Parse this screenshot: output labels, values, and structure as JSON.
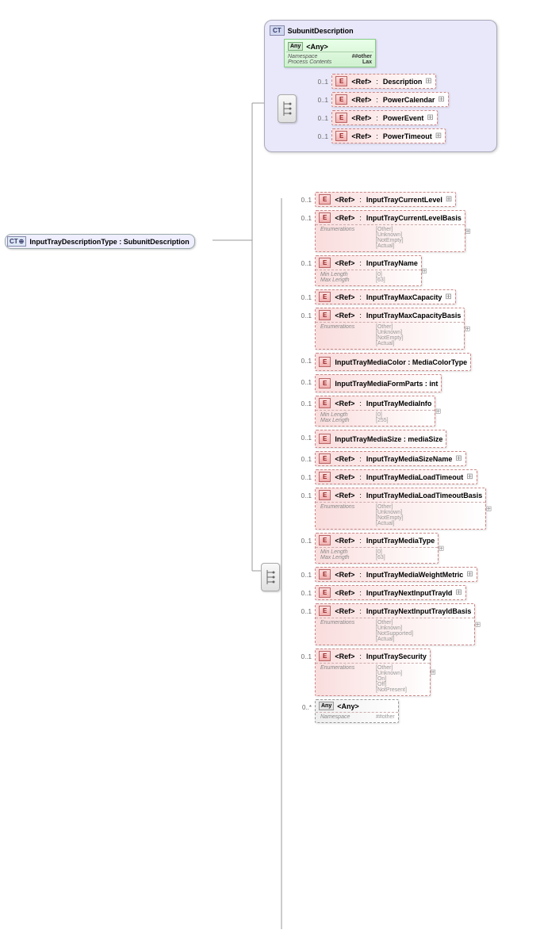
{
  "root": {
    "label": "InputTrayDescriptionType : SubunitDescription",
    "ct": "CT"
  },
  "subunit": {
    "ct": "CT",
    "title": "SubunitDescription",
    "any": {
      "ic": "Any",
      "label": "<Any>",
      "ns_l": "Namespace",
      "ns_v": "##other",
      "pc_l": "Process Contents",
      "pc_v": "Lax"
    },
    "items": [
      {
        "occ": "0..1",
        "ref": "<Ref>",
        "name": "Description"
      },
      {
        "occ": "0..1",
        "ref": "<Ref>",
        "name": "PowerCalendar"
      },
      {
        "occ": "0..1",
        "ref": "<Ref>",
        "name": "PowerEvent"
      },
      {
        "occ": "0..1",
        "ref": "<Ref>",
        "name": "PowerTimeout"
      }
    ]
  },
  "main": [
    {
      "occ": "0..1",
      "ref": "<Ref>",
      "name": "InputTrayCurrentLevel"
    },
    {
      "occ": "0..1",
      "ref": "<Ref>",
      "name": "InputTrayCurrentLevelBasis",
      "enum": [
        "[Other]",
        "[Unknown]",
        "[NotEmpty]",
        "[Actual]"
      ],
      "enum_l": "Enumerations"
    },
    {
      "occ": "0..1",
      "ref": "<Ref>",
      "name": "InputTrayName",
      "len": {
        "min_l": "Min Length",
        "min_v": "[0]",
        "max_l": "Max Length",
        "max_v": "[63]"
      }
    },
    {
      "occ": "0..1",
      "ref": "<Ref>",
      "name": "InputTrayMaxCapacity"
    },
    {
      "occ": "0..1",
      "ref": "<Ref>",
      "name": "InputTrayMaxCapacityBasis",
      "enum": [
        "[Other]",
        "[Unknown]",
        "[NotEmpty]",
        "[Actual]"
      ],
      "enum_l": "Enumerations"
    },
    {
      "occ": "0..1",
      "plain": "InputTrayMediaColor : MediaColorType"
    },
    {
      "occ": "0..1",
      "plain": "InputTrayMediaFormParts : int"
    },
    {
      "occ": "0..1",
      "ref": "<Ref>",
      "name": "InputTrayMediaInfo",
      "len": {
        "min_l": "Min Length",
        "min_v": "[0]",
        "max_l": "Max Length",
        "max_v": "[255]"
      }
    },
    {
      "occ": "0..1",
      "plain": "InputTrayMediaSize : mediaSize"
    },
    {
      "occ": "0..1",
      "ref": "<Ref>",
      "name": "InputTrayMediaSizeName"
    },
    {
      "occ": "0..1",
      "ref": "<Ref>",
      "name": "InputTrayMediaLoadTimeout"
    },
    {
      "occ": "0..1",
      "ref": "<Ref>",
      "name": "InputTrayMediaLoadTimeoutBasis",
      "enum": [
        "[Other]",
        "[Unknown]",
        "[NotEmpty]",
        "[Actual]"
      ],
      "enum_l": "Enumerations"
    },
    {
      "occ": "0..1",
      "ref": "<Ref>",
      "name": "InputTrayMediaType",
      "len": {
        "min_l": "Min Length",
        "min_v": "[0]",
        "max_l": "Max Length",
        "max_v": "[63]"
      }
    },
    {
      "occ": "0..1",
      "ref": "<Ref>",
      "name": "InputTrayMediaWeightMetric"
    },
    {
      "occ": "0..1",
      "ref": "<Ref>",
      "name": "InputTrayNextInputTrayId"
    },
    {
      "occ": "0..1",
      "ref": "<Ref>",
      "name": "InputTrayNextInputTrayIdBasis",
      "enum": [
        "[Other]",
        "[Unknown]",
        "[NotSupported]",
        "[Actual]"
      ],
      "enum_l": "Enumerations"
    },
    {
      "occ": "0..1",
      "ref": "<Ref>",
      "name": "InputTraySecurity",
      "enum": [
        "[Other]",
        "[Unknown]",
        "[On]",
        "[Off]",
        "[NotPresent]"
      ],
      "enum_l": "Enumerations"
    },
    {
      "occ": "0..*",
      "any": true,
      "ic": "Any",
      "label": "<Any>",
      "ns_l": "Namespace",
      "ns_v": "##other"
    }
  ]
}
